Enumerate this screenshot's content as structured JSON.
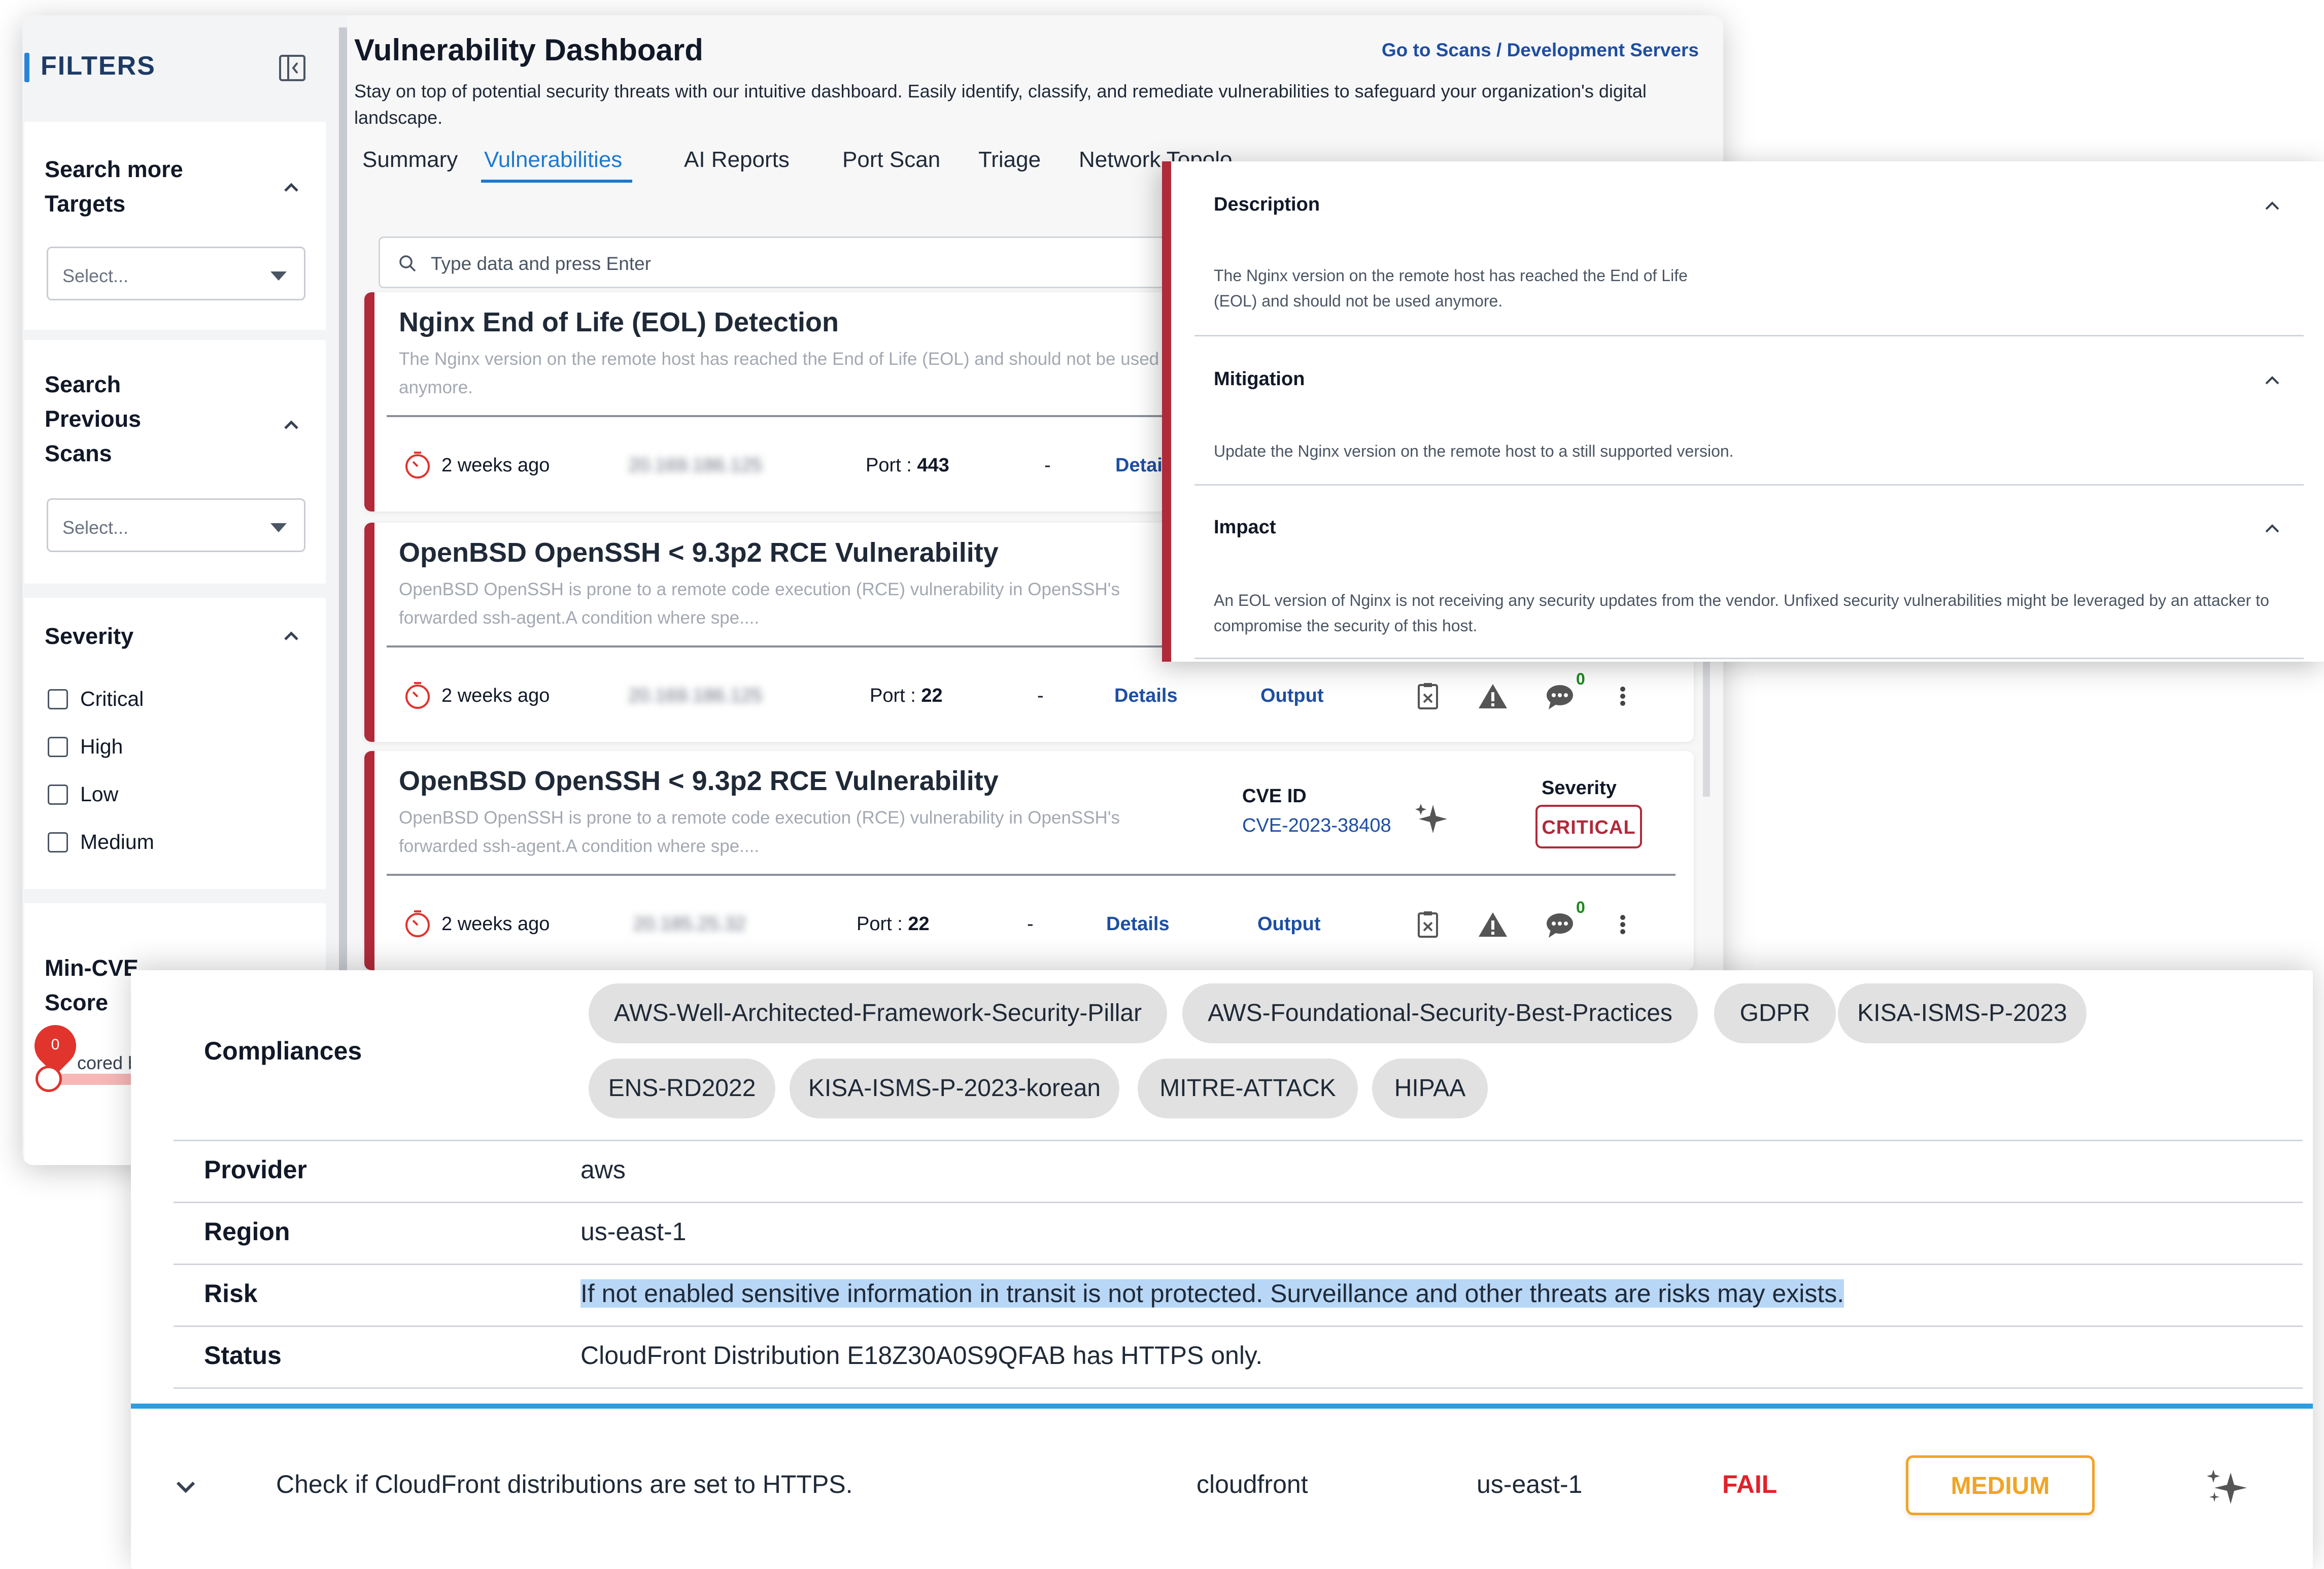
{
  "sidebar": {
    "title": "FILTERS",
    "search_targets": {
      "label": "Search more Targets",
      "select_placeholder": "Select..."
    },
    "search_scans": {
      "label": "Search Previous Scans",
      "select_placeholder": "Select..."
    },
    "severity": {
      "label": "Severity",
      "options": [
        "Critical",
        "High",
        "Low",
        "Medium"
      ]
    },
    "min_cve": {
      "label": "Min-CVE Score",
      "slider_value": "0",
      "scored_text": "cored be"
    }
  },
  "header": {
    "title": "Vulnerability Dashboard",
    "subtitle": "Stay on top of potential security threats with our intuitive dashboard. Easily identify, classify, and remediate vulnerabilities to safeguard your organization's digital landscape.",
    "breadcrumb": "Go to Scans / Development Servers"
  },
  "tabs": [
    "Summary",
    "Vulnerabilities",
    "AI Reports",
    "Port Scan",
    "Triage",
    "Network Topolo"
  ],
  "active_tab": "Vulnerabilities",
  "search": {
    "placeholder": "Type data and press Enter"
  },
  "vulns": [
    {
      "title": "Nginx End of Life (EOL) Detection",
      "desc": "The Nginx version on the remote host has reached the End of Life (EOL) and should not be used anymore.",
      "age": "2 weeks ago",
      "ip": "20.169.186.125",
      "port_label": "Port :",
      "port": "443",
      "sep": "-",
      "details": "Details"
    },
    {
      "title": "OpenBSD OpenSSH < 9.3p2 RCE Vulnerability",
      "desc": "OpenBSD OpenSSH is prone to a remote code execution (RCE) vulnerability in OpenSSH's forwarded ssh-agent.A condition where spe....",
      "age": "2 weeks ago",
      "ip": "20.169.186.125",
      "port_label": "Port :",
      "port": "22",
      "sep": "-",
      "details": "Details",
      "output": "Output",
      "comments": "0"
    },
    {
      "title": "OpenBSD OpenSSH < 9.3p2 RCE Vulnerability",
      "desc": "OpenBSD OpenSSH is prone to a remote code execution (RCE) vulnerability in OpenSSH's forwarded ssh-agent.A condition where spe....",
      "age": "2 weeks ago",
      "ip": "20.185.25.32",
      "port_label": "Port :",
      "port": "22",
      "sep": "-",
      "details": "Details",
      "output": "Output",
      "comments": "0",
      "cve_label": "CVE ID",
      "cve_id": "CVE-2023-38408",
      "severity_label": "Severity",
      "severity": "CRITICAL"
    }
  ],
  "detail": {
    "description_title": "Description",
    "description": "The Nginx version on the remote host has reached the End of Life (EOL) and should not be used anymore.",
    "mitigation_title": "Mitigation",
    "mitigation": "Update the Nginx version on the remote host to a still supported version.",
    "impact_title": "Impact",
    "impact": "An EOL version of Nginx is not receiving any security updates from the vendor. Unfixed security vulnerabilities might be leveraged by an attacker to compromise the security of this host."
  },
  "compliance": {
    "compliances_label": "Compliances",
    "chips": [
      "AWS-Well-Architected-Framework-Security-Pillar",
      "AWS-Foundational-Security-Best-Practices",
      "GDPR",
      "KISA-ISMS-P-2023",
      "ENS-RD2022",
      "KISA-ISMS-P-2023-korean",
      "MITRE-ATTACK",
      "HIPAA"
    ],
    "provider_label": "Provider",
    "provider": "aws",
    "region_label": "Region",
    "region": "us-east-1",
    "risk_label": "Risk",
    "risk": "If not enabled sensitive information in transit is not protected. Surveillance and other threats are risks may exists.",
    "status_label": "Status",
    "status": "CloudFront Distribution E18Z30A0S9QFAB has HTTPS only.",
    "check": {
      "title": "Check if CloudFront distributions are set to HTTPS.",
      "service": "cloudfront",
      "region": "us-east-1",
      "result": "FAIL",
      "severity": "MEDIUM"
    }
  },
  "colors": {
    "accent": "#1c7ad1",
    "critical": "#b02a3a",
    "fail": "#e3202a",
    "medium": "#f0a425",
    "link": "#1e4ea1"
  },
  "icons": [
    "collapse-panel-icon",
    "chevron-up-icon",
    "search-icon",
    "clock-icon",
    "clipboard-x-icon",
    "warning-icon",
    "comment-icon",
    "more-vertical-icon",
    "sparkles-icon",
    "chevron-down-icon"
  ]
}
